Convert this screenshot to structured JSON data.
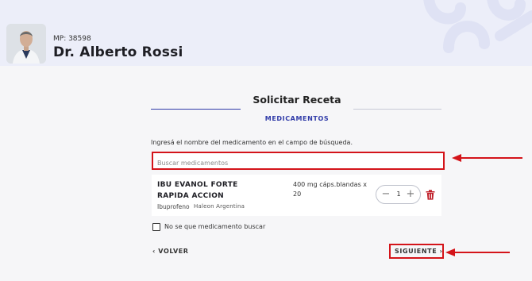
{
  "doctor": {
    "mp": "MP: 38598",
    "name": "Dr. Alberto Rossi"
  },
  "page": {
    "title": "Solicitar Receta",
    "subtitle": "MEDICAMENTOS",
    "instruction": "Ingresá el nombre del medicamento en el campo de búsqueda."
  },
  "search": {
    "placeholder": "Buscar medicamentos",
    "value": ""
  },
  "medication": {
    "name": "IBU EVANOL FORTE RAPIDA ACCION",
    "generic": "Ibuprofeno",
    "lab": "Haleon Argentina",
    "presentation": "400 mg cáps.blandas x 20",
    "quantity": "1",
    "minus_icon": "minus-icon",
    "plus_icon": "plus-icon",
    "delete_icon": "trash-icon"
  },
  "unknown_checkbox": {
    "label": "No se que medicamento buscar",
    "checked": false
  },
  "nav": {
    "back_label": "VOLVER",
    "next_label": "SIGUIENTE"
  },
  "colors": {
    "accent_blue": "#2f3aa8",
    "highlight_red": "#d4141a",
    "header_bg": "#eceef9",
    "page_bg": "#f6f6f8"
  }
}
